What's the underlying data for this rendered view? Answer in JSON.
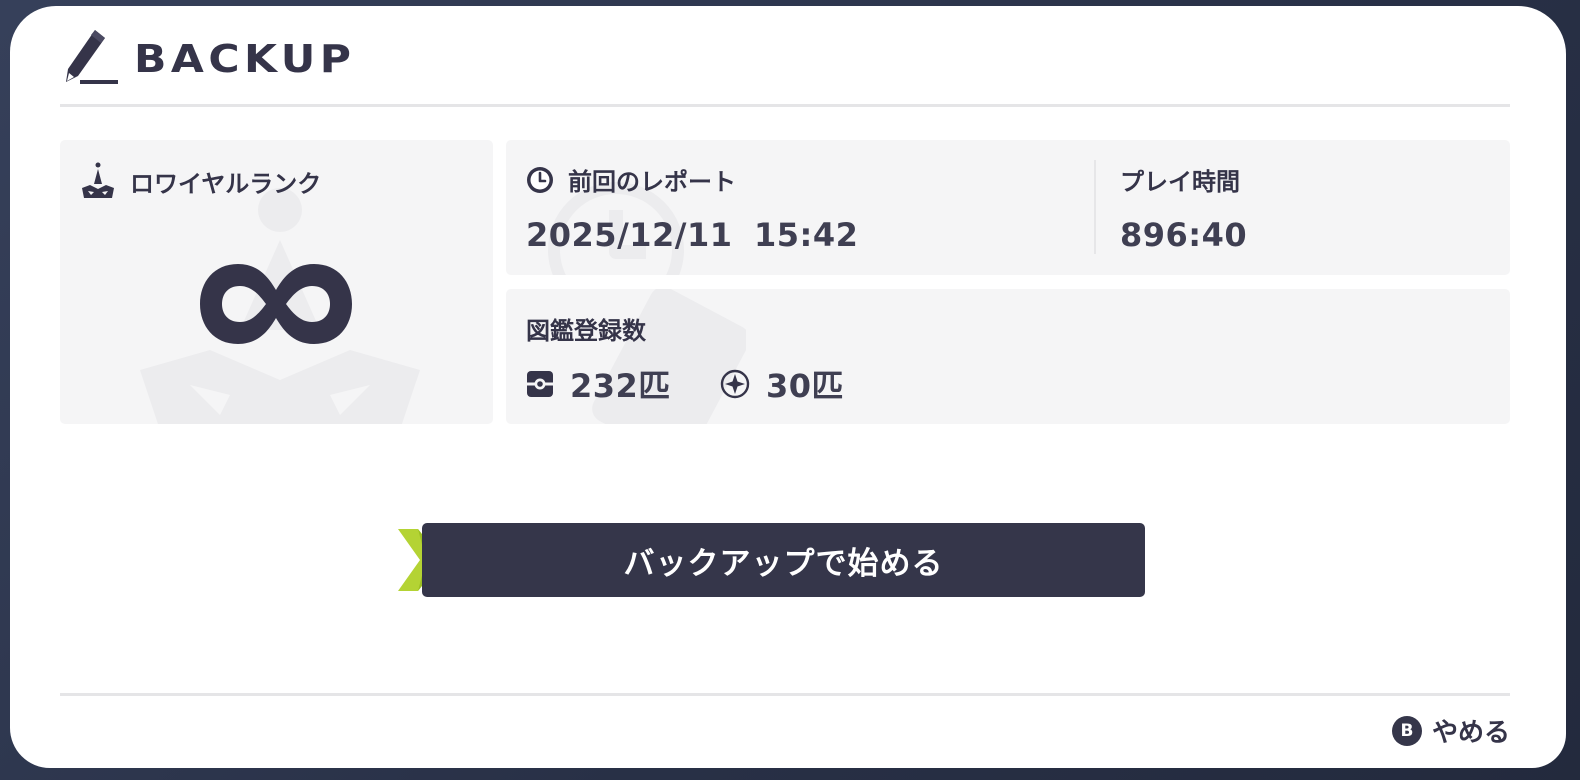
{
  "header": {
    "title": "BACKUP",
    "icon": "pencil-icon"
  },
  "rank": {
    "label": "ロワイヤルランク",
    "icon": "crown-icon",
    "value_icon": "infinity-icon"
  },
  "report": {
    "label": "前回のレポート",
    "icon": "clock-icon",
    "date": "2025/12/11",
    "time": "15:42",
    "playtime_label": "プレイ時間",
    "playtime": "896:40"
  },
  "pokedex": {
    "label": "図鑑登録数",
    "caught_icon": "pokedex-icon",
    "caught": "232匹",
    "other_icon": "sparkle-orb-icon",
    "other": "30匹"
  },
  "start_button": {
    "label": "バックアップで始める",
    "cursor_icon": "chevron-right-icon"
  },
  "cancel": {
    "button_glyph": "B",
    "label": "やめる"
  },
  "colors": {
    "primary": "#353449",
    "panel": "#f5f5f6",
    "accent": "#b4d334",
    "background": "#2c3449"
  }
}
